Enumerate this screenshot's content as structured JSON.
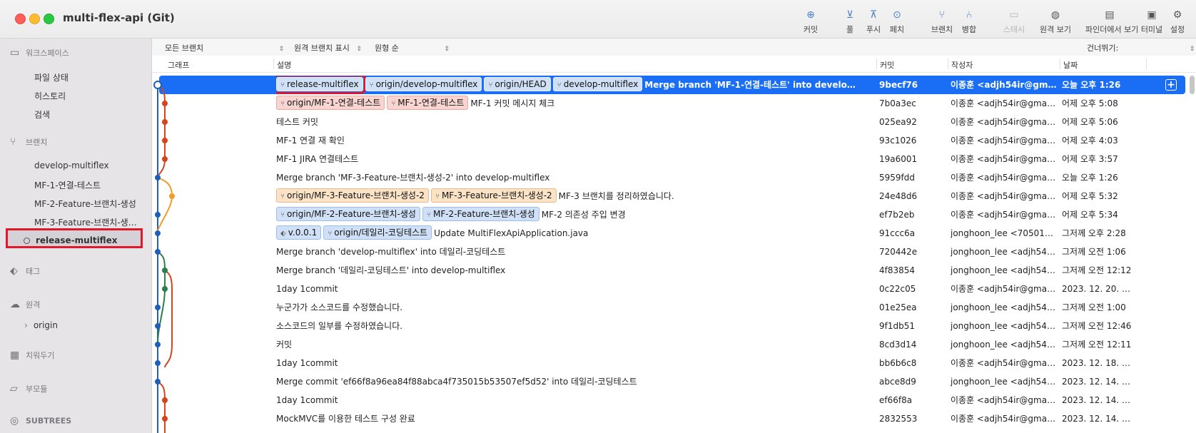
{
  "window": {
    "title": "multi-flex-api (Git)"
  },
  "toolbar": {
    "commit": "커밋",
    "pull": "풀",
    "push": "푸시",
    "fetch": "페치",
    "branch": "브랜치",
    "merge": "병합",
    "stash": "스태시",
    "show_remote": "원격 보기",
    "show_in_finder": "파인더에서 보기",
    "terminal": "터미널",
    "settings": "설정"
  },
  "sidebar": {
    "workspace": {
      "title": "워크스페이스",
      "items": [
        "파일 상태",
        "히스토리",
        "검색"
      ]
    },
    "branches": {
      "title": "브랜치",
      "items": [
        "develop-multiflex",
        "MF-1-연결-테스트",
        "MF-2-Feature-브랜치-생성",
        "MF-3-Feature-브랜치-생성-2"
      ],
      "selected": "release-multiflex"
    },
    "tags": {
      "title": "태그"
    },
    "remotes": {
      "title": "원격",
      "items": [
        "origin"
      ]
    },
    "stashes": {
      "title": "치워두기"
    },
    "submodules": {
      "title": "부모듈"
    },
    "subtrees": {
      "title": "SUBTREES"
    }
  },
  "filterbar": {
    "all_branches": "모든 브랜치",
    "show_remote_branches": "원격 브랜치 표시",
    "ancestor_order": "원형 순",
    "jump_to": "건너뛰기:"
  },
  "columns": {
    "graph": "그래프",
    "description": "설명",
    "commit": "커밋",
    "author": "작성자",
    "date": "날짜"
  },
  "commits": [
    {
      "tags": [
        {
          "label": "release-multiflex",
          "style": "blue",
          "icon": "branch",
          "highlight": true
        },
        {
          "label": "origin/develop-multiflex",
          "style": "blue",
          "icon": "branch"
        },
        {
          "label": "origin/HEAD",
          "style": "blue",
          "icon": "branch"
        },
        {
          "label": "develop-multiflex",
          "style": "blue",
          "icon": "branch"
        }
      ],
      "message": "Merge branch 'MF-1-연결-테스트' into develop-multiflex",
      "hash": "9becf76",
      "author": "이종훈 <adjh54ir@gmail....",
      "date": "오늘 오후 1:26",
      "selected": true
    },
    {
      "tags": [
        {
          "label": "origin/MF-1-연결-테스트",
          "style": "pink",
          "icon": "branch"
        },
        {
          "label": "MF-1-연결-테스트",
          "style": "pink",
          "icon": "branch"
        }
      ],
      "message": "MF-1 커밋 메시지 체크",
      "hash": "7b0a3ec",
      "author": "이종훈 <adjh54ir@gmail.co...",
      "date": "어제 오후 5:08"
    },
    {
      "tags": [],
      "message": "테스트 커밋",
      "hash": "025ea92",
      "author": "이종훈 <adjh54ir@gmail.co...",
      "date": "어제 오후 5:06"
    },
    {
      "tags": [],
      "message": "MF-1 연결 재 확인",
      "hash": "93c1026",
      "author": "이종훈 <adjh54ir@gmail.co...",
      "date": "어제 오후 4:03"
    },
    {
      "tags": [],
      "message": "MF-1 JIRA 연결테스트",
      "hash": "19a6001",
      "author": "이종훈 <adjh54ir@gmail.co...",
      "date": "어제 오후 3:57"
    },
    {
      "tags": [],
      "message": "Merge branch 'MF-3-Feature-브랜치-생성-2' into develop-multiflex",
      "hash": "5959fdd",
      "author": "이종훈 <adjh54ir@gmail.co...",
      "date": "오늘 오후 1:26"
    },
    {
      "tags": [
        {
          "label": "origin/MF-3-Feature-브랜치-생성-2",
          "style": "orange",
          "icon": "branch"
        },
        {
          "label": "MF-3-Feature-브랜치-생성-2",
          "style": "orange",
          "icon": "branch"
        }
      ],
      "message": "MF-3 브랜치를 정리하였습니다.",
      "hash": "24e48d6",
      "author": "이종훈 <adjh54ir@gmail.co...",
      "date": "어제 오후 5:32"
    },
    {
      "tags": [
        {
          "label": "origin/MF-2-Feature-브랜치-생성",
          "style": "blue",
          "icon": "branch"
        },
        {
          "label": "MF-2-Feature-브랜치-생성",
          "style": "blue",
          "icon": "branch"
        }
      ],
      "message": "MF-2 의존성 주입 변경",
      "hash": "ef7b2eb",
      "author": "이종훈 <adjh54ir@gmail.co...",
      "date": "어제 오후 5:34"
    },
    {
      "tags": [
        {
          "label": "v.0.0.1",
          "style": "blue",
          "icon": "tag"
        },
        {
          "label": "origin/데일리-코딩테스트",
          "style": "blue",
          "icon": "branch"
        }
      ],
      "message": "Update MultiFlexApiApplication.java",
      "hash": "91ccc6a",
      "author": "jonghoon_lee <70501374...",
      "date": "그저께 오후 2:28"
    },
    {
      "tags": [],
      "message": "Merge branch 'develop-multiflex' into 데일리-코딩테스트",
      "hash": "720442e",
      "author": "jonghoon_lee <adjh54ir@...",
      "date": "그저께 오전 1:06"
    },
    {
      "tags": [],
      "message": "Merge branch '데일리-코딩테스트' into develop-multiflex",
      "hash": "4f83854",
      "author": "jonghoon_lee <adjh54ir@...",
      "date": "그저께 오전 12:12"
    },
    {
      "tags": [],
      "message": "1day 1commit",
      "hash": "0c22c05",
      "author": "이종훈 <adjh54ir@gmail.co...",
      "date": "2023. 12. 20. 오..."
    },
    {
      "tags": [],
      "message": "누군가가 소스코드를 수정했습니다.",
      "hash": "01e25ea",
      "author": "jonghoon_lee <adjh54ir@...",
      "date": "그저께 오전 1:00"
    },
    {
      "tags": [],
      "message": "소스코드의 일부를 수정하였습니다.",
      "hash": "9f1db51",
      "author": "jonghoon_lee <adjh54ir@...",
      "date": "그저께 오전 12:46"
    },
    {
      "tags": [],
      "message": "커밋",
      "hash": "8cd3d14",
      "author": "jonghoon_lee <adjh54ir@...",
      "date": "그저께 오전 12:11"
    },
    {
      "tags": [],
      "message": "1day 1commit",
      "hash": "bb6b6c8",
      "author": "이종훈 <adjh54ir@gmail.co...",
      "date": "2023. 12. 18. 오..."
    },
    {
      "tags": [],
      "message": "Merge commit 'ef66f8a96ea84f88abca4f735015b53507ef5d52' into 데일리-코딩테스트",
      "hash": "abce8d9",
      "author": "jonghoon_lee <adjh54ir@...",
      "date": "2023. 12. 14. 오..."
    },
    {
      "tags": [],
      "message": "1day 1commit",
      "hash": "ef66f8a",
      "author": "이종훈 <adjh54ir@gmail.co...",
      "date": "2023. 12. 14. 오..."
    },
    {
      "tags": [],
      "message": "MockMVC를 이용한 테스트 구성 완료",
      "hash": "2832553",
      "author": "이종훈 <adjh54ir@gmail.co...",
      "date": "2023. 12. 14. 오..."
    }
  ],
  "graph_colors": {
    "main": "#1f5fb8",
    "mf1": "#d2451e",
    "mf3": "#f39a2a",
    "daily": "#2e7d4f"
  }
}
